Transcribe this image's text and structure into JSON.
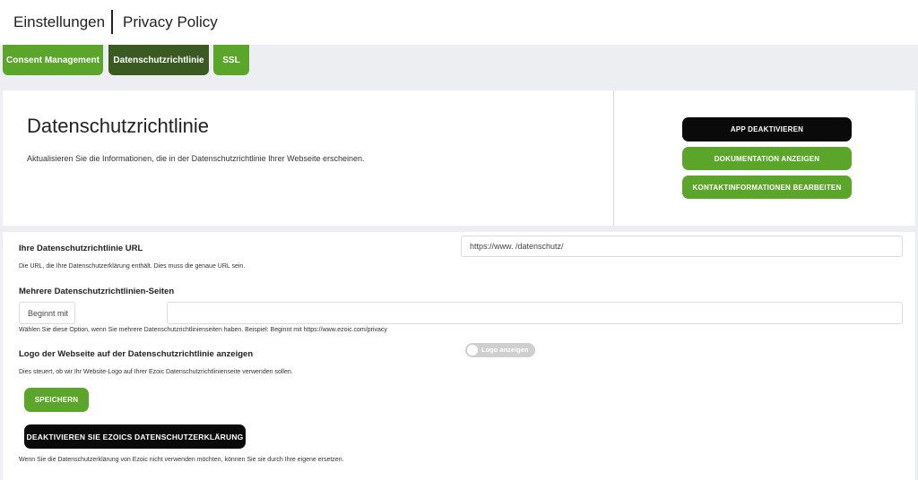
{
  "header": {
    "title": "Einstellungen",
    "subtitle": "Privacy Policy"
  },
  "tabs": [
    {
      "label": "Consent Management"
    },
    {
      "label": "Datenschutzrichtlinie"
    },
    {
      "label": "SSL"
    }
  ],
  "intro": {
    "title": "Datenschutzrichtlinie",
    "description": "Aktualisieren Sie die Informationen, die in der Datenschutzrichtlinie Ihrer Webseite erscheinen."
  },
  "actions": {
    "deactivate_app": "APP DEAKTIVIEREN",
    "show_docs": "DOKUMENTATION ANZEIGEN",
    "edit_contact": "KONTAKTINFORMATIONEN BEARBEITEN"
  },
  "form": {
    "url": {
      "label": "Ihre Datenschutzrichtlinie URL",
      "value": "https://www.                    /datenschutz/",
      "help": "Die URL, die Ihre Datenschutzerklärung enthält. Dies muss die genaue URL sein."
    },
    "multi": {
      "label": "Mehrere Datenschutzrichtlinien-Seiten",
      "prefix_placeholder": "Beginnt mit",
      "value": "",
      "help": "Wählen Sie diese Option, wenn Sie mehrere Datenschutzrichtlinienseiten haben. Beispiel: Beginnt mit https://www.ezoic.com/privacy"
    },
    "logo": {
      "label": "Logo der Webseite auf der Datenschutzrichtlinie anzeigen",
      "toggle_label": "Logo anzeigen",
      "toggle_on": false,
      "help": "Dies steuert, ob wir Ihr Website-Logo auf Ihrer Ezoic Datenschutzrichtlinienseite verwenden sollen."
    },
    "save_label": "SPEICHERN",
    "disable_label": "DEAKTIVIEREN SIE EZOICS DATENSCHUTZERKLÄRUNG",
    "disable_help": "Wenn Sie die Datenschutzerklärung von Ezoic nicht verwenden möchten, können Sie sie durch Ihre eigene ersetzen."
  },
  "colors": {
    "green": "#5ba52a",
    "dark_green": "#3a5a22",
    "black": "#0a0a0a"
  }
}
